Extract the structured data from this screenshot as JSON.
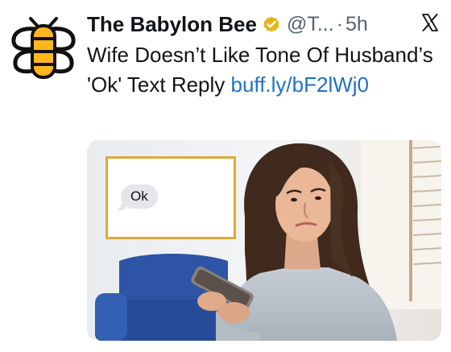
{
  "account": {
    "name": "The Babylon Bee",
    "handle": "@T...",
    "separator": "·",
    "time": "5h"
  },
  "tweet": {
    "text": "Wife Doesn’t Like Tone Of Husband’s 'Ok' Text Reply ",
    "link": "buff.ly/bF2lWj0"
  },
  "media": {
    "bubble_text": "Ok"
  },
  "icons": {
    "avatar": "babylon-bee-logo",
    "verified": "gold-verified-badge",
    "platform": "x-logo"
  },
  "colors": {
    "brand_yellow": "#ffb81c",
    "badge_gold": "#e2b719",
    "link_blue": "#1d72c8",
    "frame_border": "#dfa83a"
  }
}
